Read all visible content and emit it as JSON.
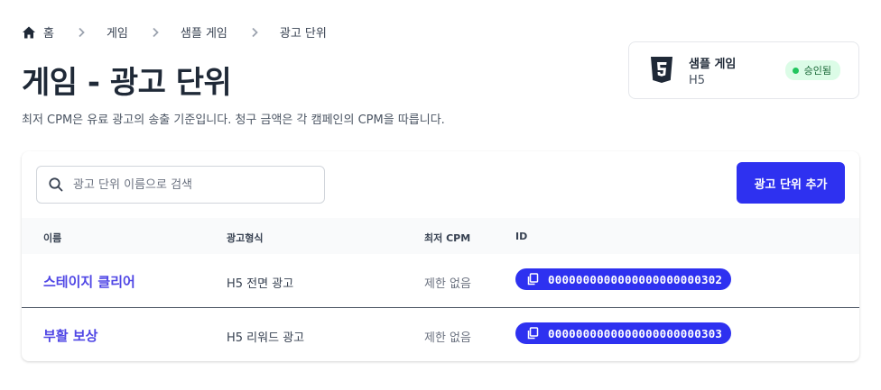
{
  "breadcrumb": {
    "items": [
      "홈",
      "게임",
      "샘플 게임",
      "광고 단위"
    ]
  },
  "header": {
    "title": "게임 - 광고 단위",
    "description": "최저 CPM은 유료 광고의 송출 기준입니다. 청구 금액은 각 캠페인의 CPM을 따릅니다."
  },
  "game_card": {
    "name": "샘플 게임",
    "platform": "H5",
    "status": "승인됨",
    "icon": "html5-icon"
  },
  "toolbar": {
    "search_placeholder": "광고 단위 이름으로 검색",
    "search_value": "",
    "add_label": "광고 단위 추가"
  },
  "table": {
    "columns": [
      "이름",
      "광고형식",
      "최저 CPM",
      "ID"
    ],
    "rows": [
      {
        "name": "스테이지 클리어",
        "format": "H5 전면 광고",
        "cpm": "제한 없음",
        "id": "0000000000000000000000302"
      },
      {
        "name": "부활 보상",
        "format": "H5 리워드 광고",
        "cpm": "제한 없음",
        "id": "0000000000000000000000303"
      }
    ]
  },
  "colors": {
    "accent": "#2e31f0",
    "link": "#4f46e5",
    "status_bg": "#dcfce7",
    "status_dot": "#22c55e"
  }
}
